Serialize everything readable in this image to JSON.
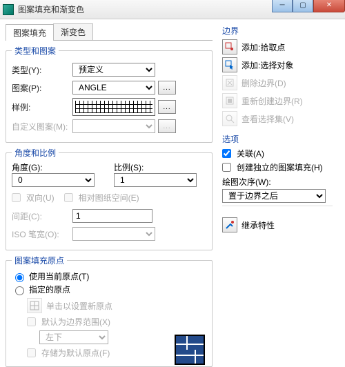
{
  "window": {
    "title": "图案填充和渐变色"
  },
  "tabs": {
    "fill": "图案填充",
    "gradient": "渐变色"
  },
  "group_type": {
    "legend": "类型和图案",
    "type_label": "类型(Y):",
    "type_value": "预定义",
    "pattern_label": "图案(P):",
    "pattern_value": "ANGLE",
    "swatch_label": "样例:",
    "custom_label": "自定义图案(M):"
  },
  "group_scale": {
    "legend": "角度和比例",
    "angle_label": "角度(G):",
    "angle_value": "0",
    "scale_label": "比例(S):",
    "scale_value": "1",
    "cb_bidir": "双向(U)",
    "cb_paperspace": "相对图纸空间(E)",
    "spacing_label": "间距(C):",
    "spacing_value": "1",
    "iso_label": "ISO 笔宽(O):"
  },
  "group_origin": {
    "legend": "图案填充原点",
    "r_current": "使用当前原点(T)",
    "r_spec": "指定的原点",
    "btn_click": "单击以设置新原点",
    "cb_extent": "默认为边界范围(X)",
    "corner_value": "左下",
    "cb_store": "存储为默认原点(F)"
  },
  "boundary": {
    "header": "边界",
    "add_pick": "添加:拾取点",
    "add_select": "添加:选择对象",
    "delete": "删除边界(D)",
    "recreate": "重新创建边界(R)",
    "viewsel": "查看选择集(V)"
  },
  "options": {
    "header": "选项",
    "cb_assoc": "关联(A)",
    "cb_indep": "创建独立的图案填充(H)",
    "draworder_label": "绘图次序(W):",
    "draworder_value": "置于边界之后"
  },
  "inherit": "继承特性"
}
